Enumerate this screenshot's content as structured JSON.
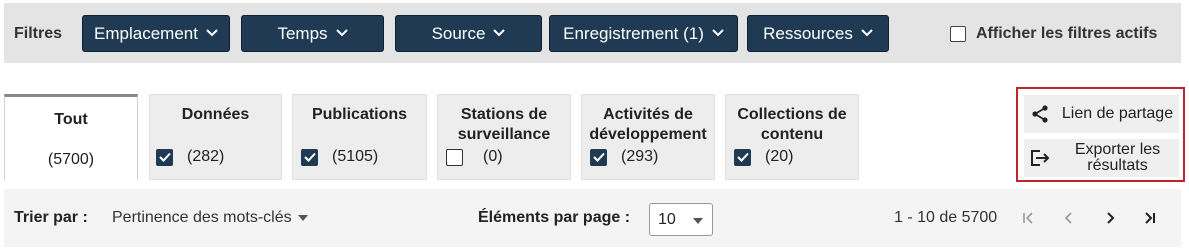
{
  "filters": {
    "label": "Filtres",
    "buttons": [
      "Emplacement",
      "Temps",
      "Source",
      "Enregistrement (1)",
      "Ressources"
    ],
    "active_toggle": {
      "label": "Afficher les filtres actifs",
      "checked": false
    }
  },
  "tabs": [
    {
      "title": "Tout",
      "count": "(5700)",
      "active": true
    },
    {
      "title": "Données",
      "count": "(282)",
      "checked": true
    },
    {
      "title": "Publications",
      "count": "(5105)",
      "checked": true
    },
    {
      "title": "Stations de surveillance",
      "count": "(0)",
      "checked": false
    },
    {
      "title": "Activités de développement",
      "count": "(293)",
      "checked": true
    },
    {
      "title": "Collections de contenu",
      "count": "(20)",
      "checked": true
    }
  ],
  "actions": {
    "share_label": "Lien de partage",
    "export_label": "Exporter les résultats"
  },
  "sort_bar": {
    "sort_label": "Trier par :",
    "sort_value": "Pertinence des mots-clés",
    "per_page_label": "Éléments par page :",
    "per_page_value": "10",
    "range": "1 - 10 de 5700"
  },
  "colors": {
    "filter_button_bg": "#1f3a52",
    "highlight_border": "#c0232b"
  }
}
